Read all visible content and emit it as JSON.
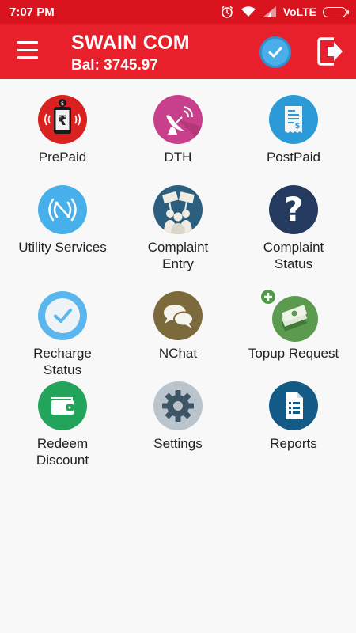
{
  "status_bar": {
    "time": "7:07 PM",
    "network": "VoLTE"
  },
  "header": {
    "title": "SWAIN COM",
    "balance": "Bal: 3745.97"
  },
  "tiles": [
    {
      "label": "PrePaid",
      "icon": "prepaid-recharge-icon"
    },
    {
      "label": "DTH",
      "icon": "satellite-dish-icon"
    },
    {
      "label": "PostPaid",
      "icon": "bill-icon"
    },
    {
      "label": "Utility Services",
      "icon": "wireless-signal-icon"
    },
    {
      "label": "Complaint\nEntry",
      "icon": "protest-people-icon"
    },
    {
      "label": "Complaint\nStatus",
      "icon": "question-mark-icon"
    },
    {
      "label": "Recharge\nStatus",
      "icon": "checkmark-icon"
    },
    {
      "label": "NChat",
      "icon": "chat-bubbles-icon"
    },
    {
      "label": "Topup Request",
      "icon": "money-stack-icon"
    },
    {
      "label": "Redeem\nDiscount",
      "icon": "wallet-icon"
    },
    {
      "label": "Settings",
      "icon": "gear-icon"
    },
    {
      "label": "Reports",
      "icon": "report-document-icon"
    }
  ]
}
